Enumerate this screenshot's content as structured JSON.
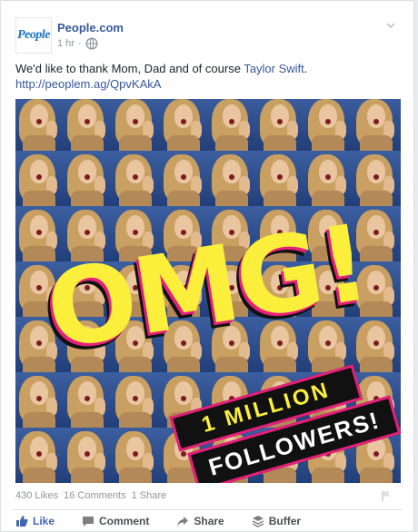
{
  "post": {
    "page_name": "People.com",
    "avatar_text": "People",
    "time": "1 hr",
    "meta_sep": "·",
    "privacy_icon": "globe-icon",
    "menu_icon": "chevron-down-icon",
    "text_before": "We'd like to thank Mom, Dad and of course ",
    "mention": "Taylor Swift",
    "text_after": ".",
    "url": "http://peoplem.ag/QpvKAkA"
  },
  "image": {
    "headline": "OMG!",
    "line1": "1 MILLION",
    "line2": "FOLLOWERS!",
    "colors": {
      "background": "#0c3f7a",
      "yellow": "#fbef3b",
      "pink": "#e61f7a",
      "black": "#111111"
    }
  },
  "stats": {
    "likes": "430 Likes",
    "comments": "16 Comments",
    "shares": "1 Share",
    "flag_icon": "flag-icon"
  },
  "actions": [
    {
      "label": "Like",
      "icon": "thumbs-up-icon"
    },
    {
      "label": "Comment",
      "icon": "comment-icon"
    },
    {
      "label": "Share",
      "icon": "share-arrow-icon"
    },
    {
      "label": "Buffer",
      "icon": "buffer-icon"
    }
  ]
}
